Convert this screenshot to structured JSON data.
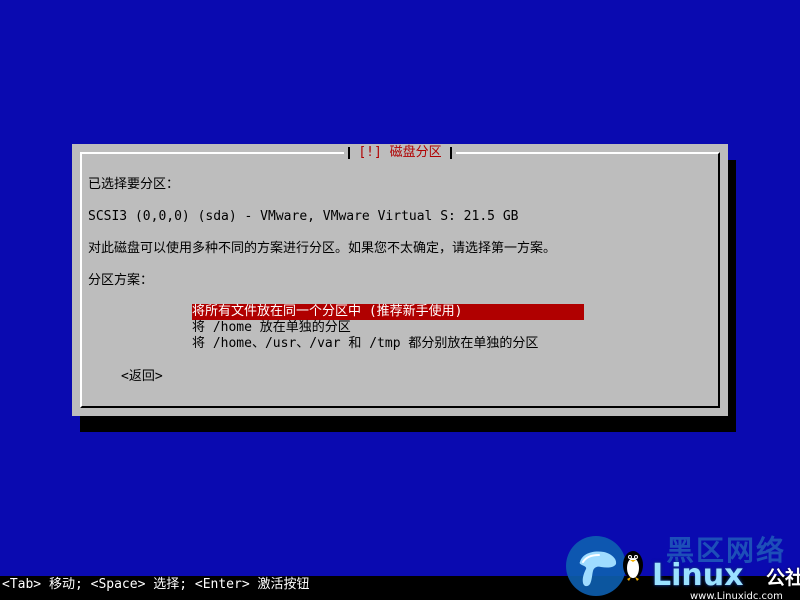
{
  "dialog": {
    "title": "[!] 磁盘分区",
    "selected_label": "已选择要分区：",
    "disk": "SCSI3 (0,0,0) (sda) - VMware, VMware Virtual S: 21.5 GB",
    "hint": "对此磁盘可以使用多种不同的方案进行分区。如果您不太确定，请选择第一方案。",
    "scheme_label": "分区方案：",
    "options": [
      "将所有文件放在同一个分区中 (推荐新手使用)",
      "将 /home 放在单独的分区",
      "将 /home、/usr、/var 和 /tmp 都分别放在单独的分区"
    ],
    "selected_option_index": 0,
    "back_label": "<返回>"
  },
  "footer": {
    "help": "<Tab> 移动; <Space> 选择; <Enter> 激活按钮"
  },
  "watermark": {
    "cn_title": "黑区网络",
    "brand": "Linux",
    "company": "公社",
    "url": "www.Linuxidc.com"
  },
  "colors": {
    "background": "#0a0ab0",
    "dialog": "#bdbdbd",
    "accent": "#b00000",
    "footer": "#000000"
  },
  "icons": {
    "watermark_logo": "mushroom-penguin-logo"
  }
}
